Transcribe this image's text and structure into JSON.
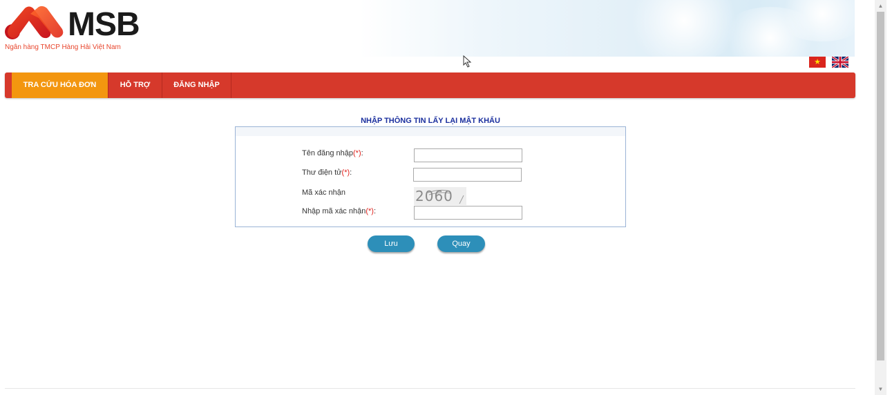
{
  "header": {
    "logo_text": "MSB",
    "logo_subtitle": "Ngân hàng TMCP Hàng Hải Việt Nam",
    "flags": [
      {
        "name": "vietnamese-flag",
        "label": "★"
      },
      {
        "name": "english-flag",
        "label": ""
      }
    ]
  },
  "nav": {
    "items": [
      {
        "label": "TRA CỨU HÓA ĐƠN",
        "active": true
      },
      {
        "label": "HỖ TRỢ",
        "active": false
      },
      {
        "label": "ĐĂNG NHẬP",
        "active": false
      }
    ]
  },
  "form": {
    "title": "NHẬP THÔNG TIN LẤY LẠI MẬT KHẨU",
    "username_label": "Tên đăng nhập",
    "email_label": "Thư điện tử",
    "captcha_label": "Mã xác nhận",
    "captcha_input_label": "Nhập mã xác nhận",
    "required_mark": "(*)",
    "colon": ":",
    "captcha_code": "2060",
    "username_value": "",
    "email_value": "",
    "captcha_value": ""
  },
  "buttons": {
    "save_label": "Lưu",
    "back_label": "Quay"
  },
  "colors": {
    "nav_bg": "#d6392b",
    "nav_active": "#f3960f",
    "button_bg": "#2d8fb9",
    "title_color": "#1a2f9e"
  }
}
